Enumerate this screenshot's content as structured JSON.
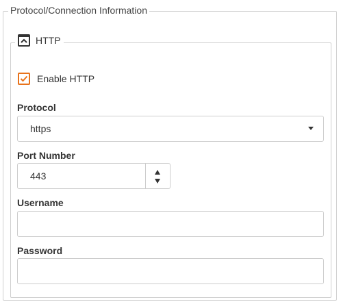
{
  "section": {
    "title": "Protocol/Connection Information"
  },
  "http_group": {
    "title": "HTTP",
    "collapse_icon": "collapse-up-icon"
  },
  "enable_http": {
    "label": "Enable HTTP",
    "checked": true,
    "accent": "#e8731c"
  },
  "protocol": {
    "label": "Protocol",
    "value": "https"
  },
  "port": {
    "label": "Port Number",
    "value": "443"
  },
  "username": {
    "label": "Username",
    "value": ""
  },
  "password": {
    "label": "Password",
    "value": ""
  }
}
